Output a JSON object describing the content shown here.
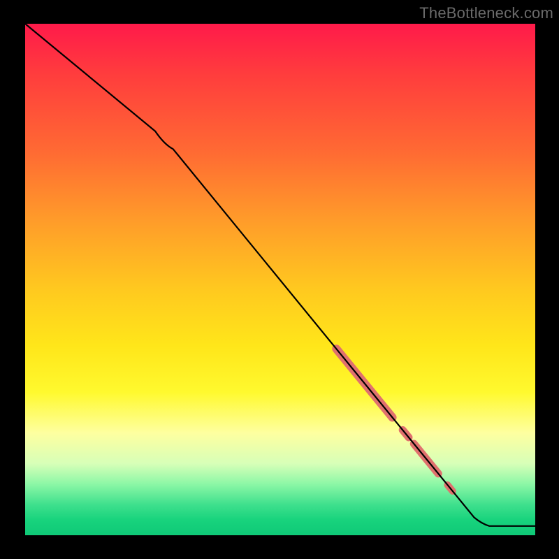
{
  "watermark": "TheBottleneck.com",
  "chart_data": {
    "type": "line",
    "title": "",
    "xlabel": "",
    "ylabel": "",
    "xlim": [
      0,
      1
    ],
    "ylim": [
      0,
      1
    ],
    "background_gradient": {
      "orientation": "vertical",
      "stops": [
        {
          "pos": 0.0,
          "color": "#ff1a4a"
        },
        {
          "pos": 0.1,
          "color": "#ff3d3d"
        },
        {
          "pos": 0.25,
          "color": "#ff6a33"
        },
        {
          "pos": 0.38,
          "color": "#ff9a2a"
        },
        {
          "pos": 0.52,
          "color": "#ffc91f"
        },
        {
          "pos": 0.63,
          "color": "#ffe61a"
        },
        {
          "pos": 0.72,
          "color": "#fff92e"
        },
        {
          "pos": 0.8,
          "color": "#feffa0"
        },
        {
          "pos": 0.86,
          "color": "#d7ffb8"
        },
        {
          "pos": 0.9,
          "color": "#8cf7a6"
        },
        {
          "pos": 0.94,
          "color": "#3fe08d"
        },
        {
          "pos": 0.97,
          "color": "#18d37d"
        },
        {
          "pos": 1.0,
          "color": "#0fc977"
        }
      ]
    },
    "series": [
      {
        "name": "main-curve",
        "color": "#000000",
        "points": [
          {
            "x": 0.0,
            "y": 1.0
          },
          {
            "x": 0.255,
            "y": 0.79
          },
          {
            "x": 0.29,
            "y": 0.755
          },
          {
            "x": 0.88,
            "y": 0.035
          },
          {
            "x": 0.91,
            "y": 0.018
          },
          {
            "x": 1.0,
            "y": 0.018
          }
        ]
      }
    ],
    "highlight_bands": [
      {
        "x_start": 0.61,
        "x_end": 0.72,
        "width": 12,
        "color": "#e0716e"
      },
      {
        "x_start": 0.74,
        "x_end": 0.752,
        "width": 11,
        "color": "#e0716e"
      },
      {
        "x_start": 0.762,
        "x_end": 0.81,
        "width": 11,
        "color": "#e0716e"
      },
      {
        "x_start": 0.828,
        "x_end": 0.838,
        "width": 10,
        "color": "#e0716e"
      }
    ]
  }
}
